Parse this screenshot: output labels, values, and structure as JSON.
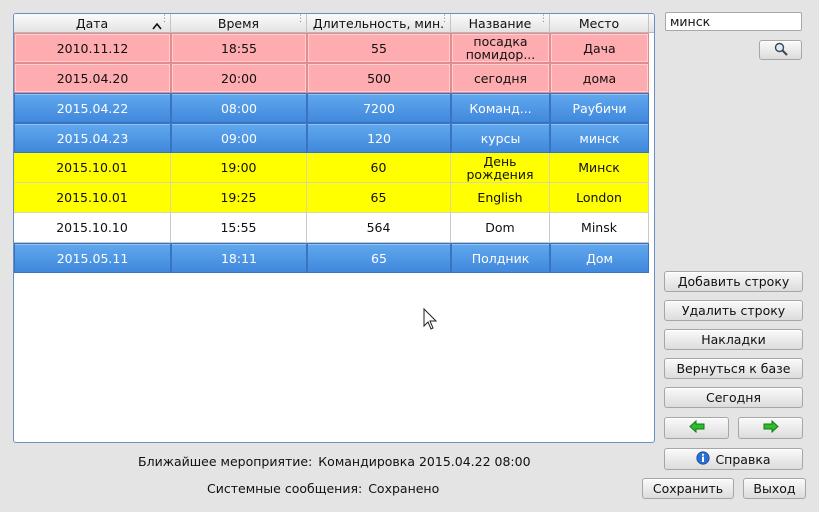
{
  "table": {
    "headers": [
      "Дата",
      "Время",
      "Длительность, мин.",
      "Название",
      "Место"
    ],
    "rows": [
      {
        "style": "pink",
        "cells": [
          "2010.11.12",
          "18:55",
          "55",
          "посадка помидор...",
          "Дача"
        ]
      },
      {
        "style": "pink",
        "cells": [
          "2015.04.20",
          "20:00",
          "500",
          "сегодня",
          "дома"
        ]
      },
      {
        "style": "blue",
        "cells": [
          "2015.04.22",
          "08:00",
          "7200",
          "Команд...",
          "Раубичи"
        ]
      },
      {
        "style": "blue",
        "cells": [
          "2015.04.23",
          "09:00",
          "120",
          "курсы",
          "минск"
        ]
      },
      {
        "style": "yellow",
        "cells": [
          "2015.10.01",
          "19:00",
          "60",
          "День рождения",
          "Минск"
        ]
      },
      {
        "style": "yellow",
        "cells": [
          "2015.10.01",
          "19:25",
          "65",
          "English",
          "London"
        ]
      },
      {
        "style": "white",
        "cells": [
          "2015.10.10",
          "15:55",
          "564",
          "Dom",
          "Minsk"
        ]
      },
      {
        "style": "blue",
        "cells": [
          "2015.05.11",
          "18:11",
          "65",
          "Полдник",
          "Дом"
        ]
      }
    ]
  },
  "search": {
    "value": "минск"
  },
  "buttons": {
    "add_row": "Добавить строку",
    "delete_row": "Удалить строку",
    "invoices": "Накладки",
    "back_to_base": "Вернуться к базе",
    "today": "Сегодня",
    "help": "Справка",
    "save": "Сохранить",
    "exit": "Выход"
  },
  "icons": {
    "search": "magnifier-icon",
    "prev": "arrow-left-green-icon",
    "next": "arrow-right-green-icon",
    "help": "info-icon"
  },
  "status": {
    "nearest_label": "Ближайшее мероприятие:",
    "nearest_value": "Командировка 2015.04.22 08:00",
    "system_label": "Системные сообщения:",
    "system_value": "Сохранено"
  },
  "colors": {
    "row_pink": "#ffacb0",
    "row_blue": "#4a92e2",
    "row_yellow": "#ffff00",
    "accent_green": "#22aa22"
  }
}
